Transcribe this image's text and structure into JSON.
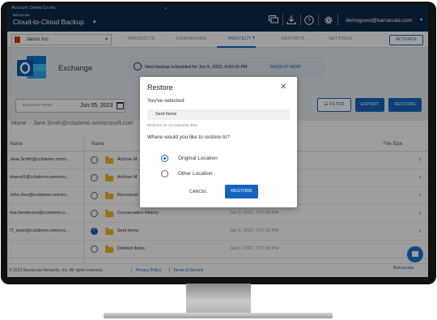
{
  "top_bar": {
    "account_label": "Account: Demo Co Inc",
    "brand_small": "Barracuda",
    "brand": "Cloud-to-Cloud Backup",
    "email": "demoguest@barracuda.com",
    "icons": [
      "chat-icon",
      "download-icon",
      "help-icon",
      "gear-icon"
    ]
  },
  "nav": {
    "org": "Janus Inc",
    "items": [
      "PRODUCTS",
      "DASHBOARD",
      "PROTECT",
      "REPORTS",
      "SETTINGS"
    ],
    "active": "PROTECT",
    "activate": "ACTIVATE"
  },
  "header": {
    "title": "Exchange",
    "schedule": "Next backup scheduled for Jun 5, 2023, 8:00:00 PM",
    "backup_now": "BACKUP NOW"
  },
  "filters": {
    "date_label": "BACKUPS FROM",
    "date_value": "Jun 05, 2023",
    "filter": "FILTER",
    "export": "EXPORT",
    "restore": "RESTORE"
  },
  "breadcrumb": {
    "home": "Home",
    "current": "Jane.Smith@ccbdemo.onmicrosoft.com"
  },
  "table": {
    "col_mailbox": "Name",
    "col_name": "Name",
    "col_size": "File Size",
    "rows": [
      {
        "mailbox": "Jane.Smith@ccbdemo.onmi...",
        "name": "Archive M",
        "date": "",
        "checked": false
      },
      {
        "mailbox": "shared1@ccbdemo.onmicro...",
        "name": "Archive M",
        "date": "",
        "checked": false
      },
      {
        "mailbox": "John.Doe@ccbdemo.onmicr...",
        "name": "Recoverat",
        "date": "",
        "checked": false
      },
      {
        "mailbox": "lisa.henderson@ccbdemo.o...",
        "name": "Conversation History",
        "date": "Jan 3, 2022, 7:07:00 PM",
        "checked": false
      },
      {
        "mailbox": "IT_team@ccbdemo.onmicro...",
        "name": "Sent Items",
        "date": "Jan 3, 2022, 7:07:00 PM",
        "checked": true
      },
      {
        "mailbox": "",
        "name": "Deleted Items",
        "date": "Jan 3, 2022, 7:07:00 PM",
        "checked": false
      }
    ]
  },
  "footer": {
    "copyright": "© 2023 Barracuda Networks, Inc. All rights reserved.",
    "privacy": "Privacy Policy",
    "terms": "Terms of Service",
    "logo": "Barracuda"
  },
  "modal": {
    "title": "Restore",
    "selected_label": "You've selected:",
    "selected_value": "Sent Items",
    "note": "Restores do not overwrite data.",
    "question": "Where would you like to restore to?",
    "options": [
      "Original Location",
      "Other Location"
    ],
    "selected_option": "Original Location",
    "cancel": "CANCEL",
    "restore": "RESTORE"
  },
  "colors": {
    "accent": "#1565c0",
    "top_bar": "#0c2b4a",
    "folder": "#f2b824"
  }
}
